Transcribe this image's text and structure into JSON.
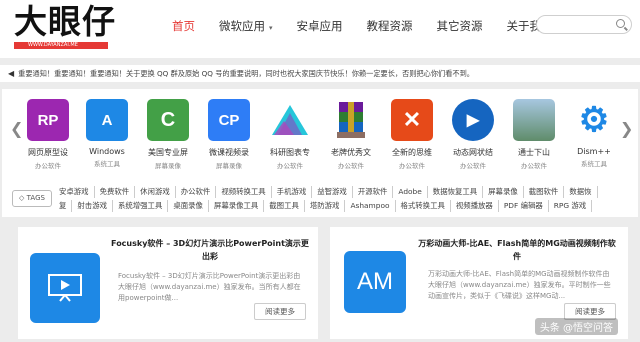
{
  "header": {
    "logo_text": "大眼仔",
    "logo_url": "WWW.DAYANZAI.ME",
    "nav": [
      {
        "label": "首页",
        "active": true
      },
      {
        "label": "微软应用",
        "caret": "▾"
      },
      {
        "label": "安卓应用"
      },
      {
        "label": "教程资源"
      },
      {
        "label": "其它资源"
      },
      {
        "label": "关于我们"
      }
    ],
    "search_placeholder": ""
  },
  "notice": {
    "text": "重要通知！重要通知！重要通知！关于更换 QQ 群及原始 QQ 号的重要说明，同时也祝大家国庆节快乐！你赖一定要长，否则把心你们看不到。"
  },
  "apps": [
    {
      "name": "网页原型设",
      "category": "办公软件",
      "icon_text": "RP",
      "color": "#9c27b0",
      "icon": "axure-rp-icon"
    },
    {
      "name": "Windows",
      "category": "系统工具",
      "icon_text": "A",
      "color": "#1e88e5",
      "icon": "windows-icon"
    },
    {
      "name": "美国专业屏",
      "category": "屏幕录像",
      "icon_text": "C",
      "color": "#43a047",
      "icon": "camtasia-icon"
    },
    {
      "name": "微课视频录",
      "category": "屏幕录像",
      "icon_text": "CP",
      "color": "#2e7df6",
      "icon": "courseplayer-icon"
    },
    {
      "name": "科研图表专",
      "category": "办公软件",
      "icon_text": "",
      "color": "#ffffff",
      "icon": "origin-chart-icon"
    },
    {
      "name": "老牌优秀文",
      "category": "办公软件",
      "icon_text": "",
      "color": "#b8860b",
      "icon": "winrar-icon"
    },
    {
      "name": "全新的思维",
      "category": "办公软件",
      "icon_text": "✕",
      "color": "#e64a19",
      "icon": "xmind-icon"
    },
    {
      "name": "动态网状结",
      "category": "办公软件",
      "icon_text": "▶",
      "color": "#1565c0",
      "icon": "network-icon"
    },
    {
      "name": "通士下山",
      "category": "办公软件",
      "icon_text": "",
      "color": "#7ba7c9",
      "icon": "landscape-icon"
    },
    {
      "name": "Dism++",
      "category": "系统工具",
      "icon_text": "⚙",
      "color": "#1e88e5",
      "icon": "dism-gear-icon"
    }
  ],
  "tags": {
    "label": "TAGS",
    "row1": [
      "安卓游戏",
      "免费软件",
      "休闲游戏",
      "办公软件",
      "视频转换工具",
      "手机游戏",
      "益智游戏",
      "开源软件",
      "Adobe",
      "数据恢复工具",
      "屏幕录像",
      "截图软件",
      "数据恢"
    ],
    "row2": [
      "复",
      "射击游戏",
      "系统增强工具",
      "桌面录像",
      "屏幕录像工具",
      "截图工具",
      "塔防游戏",
      "Ashampoo",
      "格式转换工具",
      "视频播放器",
      "PDF 编辑器",
      "RPG 游戏"
    ]
  },
  "articles": [
    {
      "title": "Focusky软件 – 3D幻灯片演示比PowerPoint演示更出彩",
      "desc": "Focusky软件 – 3D幻灯片演示比PowerPoint演示更出彩由大眼仔旭（www.dayanzai.me）独家发布。当所有人都在用powerpoint做...",
      "read_more": "阅读更多",
      "thumb_color": "#1e88e5"
    },
    {
      "title": "万彩动画大师-比AE、Flash简单的MG动画视频制作软件",
      "desc": "万彩动画大师-比AE、Flash简单的MG动画视频制作软件由大眼仔旭（www.dayanzai.me）独家发布。平时制作一些动画宣传片，类似于《飞碟说》这样MG动...",
      "read_more": "阅读更多",
      "thumb_text": "AM",
      "thumb_color": "#1e88e5"
    }
  ],
  "watermark": "头条 @悟空问答"
}
